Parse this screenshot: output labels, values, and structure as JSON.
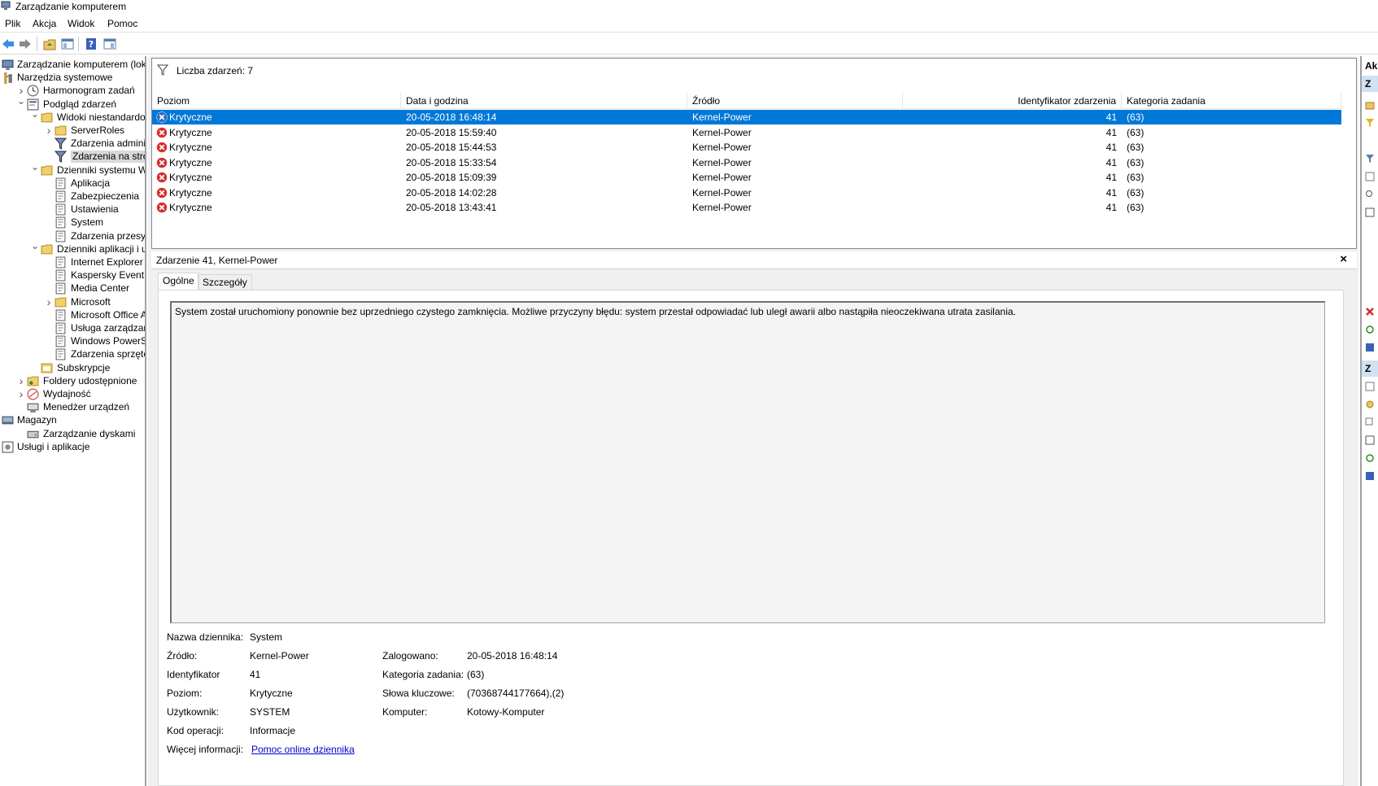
{
  "window": {
    "title": "Zarządzanie komputerem"
  },
  "menu": {
    "items": [
      "Plik",
      "Akcja",
      "Widok",
      "Pomoc"
    ]
  },
  "toolbar": {
    "icons": [
      "back-arrow-icon",
      "forward-arrow-icon",
      "up-folder-icon",
      "show-hide-tree-icon",
      "help-icon",
      "show-hide-action-pane-icon"
    ]
  },
  "tree": {
    "items": [
      {
        "label": "Zarządzanie komputerem (lokalny)",
        "icon": "computer-management-icon",
        "level": 0,
        "expander": ""
      },
      {
        "label": "Narzędzia systemowe",
        "icon": "tools-icon",
        "level": 0,
        "expander": "open"
      },
      {
        "label": "Harmonogram zadań",
        "icon": "clock-icon",
        "level": 1,
        "expander": "closed"
      },
      {
        "label": "Podgląd zdarzeń",
        "icon": "event-viewer-icon",
        "level": 1,
        "expander": "open"
      },
      {
        "label": "Widoki niestandardowe",
        "icon": "folder-icon",
        "level": 2,
        "expander": "open"
      },
      {
        "label": "ServerRoles",
        "icon": "folder-icon",
        "level": 3,
        "expander": "closed"
      },
      {
        "label": "Zdarzenia administracyjne",
        "icon": "filter-icon",
        "level": 3,
        "expander": ""
      },
      {
        "label": "Zdarzenia na stronie",
        "icon": "filter-icon",
        "level": 3,
        "expander": "",
        "selected": true
      },
      {
        "label": "Dzienniki systemu Windows",
        "icon": "folder-icon",
        "level": 2,
        "expander": "open"
      },
      {
        "label": "Aplikacja",
        "icon": "log-icon",
        "level": 3,
        "expander": ""
      },
      {
        "label": "Zabezpieczenia",
        "icon": "log-icon",
        "level": 3,
        "expander": ""
      },
      {
        "label": "Ustawienia",
        "icon": "log-icon",
        "level": 3,
        "expander": ""
      },
      {
        "label": "System",
        "icon": "log-icon",
        "level": 3,
        "expander": ""
      },
      {
        "label": "Zdarzenia przesyłane dalej",
        "icon": "log-icon",
        "level": 3,
        "expander": ""
      },
      {
        "label": "Dzienniki aplikacji i usług",
        "icon": "folder-icon",
        "level": 2,
        "expander": "open"
      },
      {
        "label": "Internet Explorer",
        "icon": "log-icon",
        "level": 3,
        "expander": ""
      },
      {
        "label": "Kaspersky Event Log",
        "icon": "log-icon",
        "level": 3,
        "expander": ""
      },
      {
        "label": "Media Center",
        "icon": "log-icon",
        "level": 3,
        "expander": ""
      },
      {
        "label": "Microsoft",
        "icon": "folder-icon",
        "level": 3,
        "expander": "closed"
      },
      {
        "label": "Microsoft Office Alerts",
        "icon": "log-icon",
        "level": 3,
        "expander": ""
      },
      {
        "label": "Usługa zarządzania kluczami",
        "icon": "log-icon",
        "level": 3,
        "expander": ""
      },
      {
        "label": "Windows PowerShell",
        "icon": "log-icon",
        "level": 3,
        "expander": ""
      },
      {
        "label": "Zdarzenia sprzętowe",
        "icon": "log-icon",
        "level": 3,
        "expander": ""
      },
      {
        "label": "Subskrypcje",
        "icon": "subscription-icon",
        "level": 2,
        "expander": ""
      },
      {
        "label": "Foldery udostępnione",
        "icon": "shared-folder-icon",
        "level": 1,
        "expander": "closed"
      },
      {
        "label": "Wydajność",
        "icon": "performance-icon",
        "level": 1,
        "expander": "closed"
      },
      {
        "label": "Menedżer urządzeń",
        "icon": "device-manager-icon",
        "level": 1,
        "expander": ""
      },
      {
        "label": "Magazyn",
        "icon": "storage-icon",
        "level": 0,
        "expander": "open"
      },
      {
        "label": "Zarządzanie dyskami",
        "icon": "disk-icon",
        "level": 1,
        "expander": ""
      },
      {
        "label": "Usługi i aplikacje",
        "icon": "services-icon",
        "level": 0,
        "expander": "closed"
      }
    ]
  },
  "events": {
    "count_label": "Liczba zdarzeń: 7",
    "columns": [
      "Poziom",
      "Data i godzina",
      "Źródło",
      "Identyfikator zdarzenia",
      "Kategoria zadania"
    ],
    "rows": [
      {
        "level": "Krytyczne",
        "datetime": "20-05-2018 16:48:14",
        "source": "Kernel-Power",
        "id": "41",
        "category": "(63)",
        "selected": true
      },
      {
        "level": "Krytyczne",
        "datetime": "20-05-2018 15:59:40",
        "source": "Kernel-Power",
        "id": "41",
        "category": "(63)"
      },
      {
        "level": "Krytyczne",
        "datetime": "20-05-2018 15:44:53",
        "source": "Kernel-Power",
        "id": "41",
        "category": "(63)"
      },
      {
        "level": "Krytyczne",
        "datetime": "20-05-2018 15:33:54",
        "source": "Kernel-Power",
        "id": "41",
        "category": "(63)"
      },
      {
        "level": "Krytyczne",
        "datetime": "20-05-2018 15:09:39",
        "source": "Kernel-Power",
        "id": "41",
        "category": "(63)"
      },
      {
        "level": "Krytyczne",
        "datetime": "20-05-2018 14:02:28",
        "source": "Kernel-Power",
        "id": "41",
        "category": "(63)"
      },
      {
        "level": "Krytyczne",
        "datetime": "20-05-2018 13:43:41",
        "source": "Kernel-Power",
        "id": "41",
        "category": "(63)"
      }
    ]
  },
  "details": {
    "title": "Zdarzenie 41, Kernel-Power",
    "close_label": "×",
    "tabs": [
      "Ogólne",
      "Szczegóły"
    ],
    "description": "System został uruchomiony ponownie bez uprzedniego czystego zamknięcia. Możliwe przyczyny błędu: system przestał odpowiadać lub uległ awarii albo nastąpiła nieoczekiwana utrata zasilania.",
    "log_name_label": "Nazwa dziennika:",
    "log_name": "System",
    "source_label": "Źródło:",
    "source": "Kernel-Power",
    "logged_label": "Zalogowano:",
    "logged": "20-05-2018 16:48:14",
    "id_label": "Identyfikator",
    "id": "41",
    "task_category_label": "Kategoria zadania:",
    "task_category": "(63)",
    "level_label": "Poziom:",
    "level": "Krytyczne",
    "keywords_label": "Słowa kluczowe:",
    "keywords": "(70368744177664),(2)",
    "user_label": "Użytkownik:",
    "user": "SYSTEM",
    "computer_label": "Komputer:",
    "computer": "Kotowy-Komputer",
    "opcode_label": "Kod operacji:",
    "opcode": "Informacje",
    "more_info_label": "Więcej informacji:",
    "more_info_link": "Pomoc online dziennika"
  },
  "actions": {
    "header1": "Ak",
    "header2": "Z",
    "header3": "Z"
  },
  "colors": {
    "selection": "#0078d7",
    "critical": "#d32f2f",
    "link": "#0000cc"
  }
}
